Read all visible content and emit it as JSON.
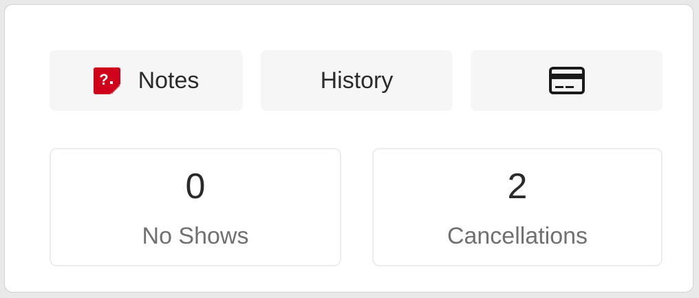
{
  "tabs": {
    "notes": {
      "label": "Notes",
      "icon": "notes-question-icon"
    },
    "history": {
      "label": "History"
    },
    "payment": {
      "icon": "credit-card-icon"
    }
  },
  "stats": {
    "no_shows": {
      "value": "0",
      "label": "No Shows"
    },
    "cancellations": {
      "value": "2",
      "label": "Cancellations"
    }
  },
  "colors": {
    "accent": "#d0021b",
    "button_bg": "#f6f6f6",
    "text": "#2b2b2b",
    "muted_text": "#707070"
  }
}
